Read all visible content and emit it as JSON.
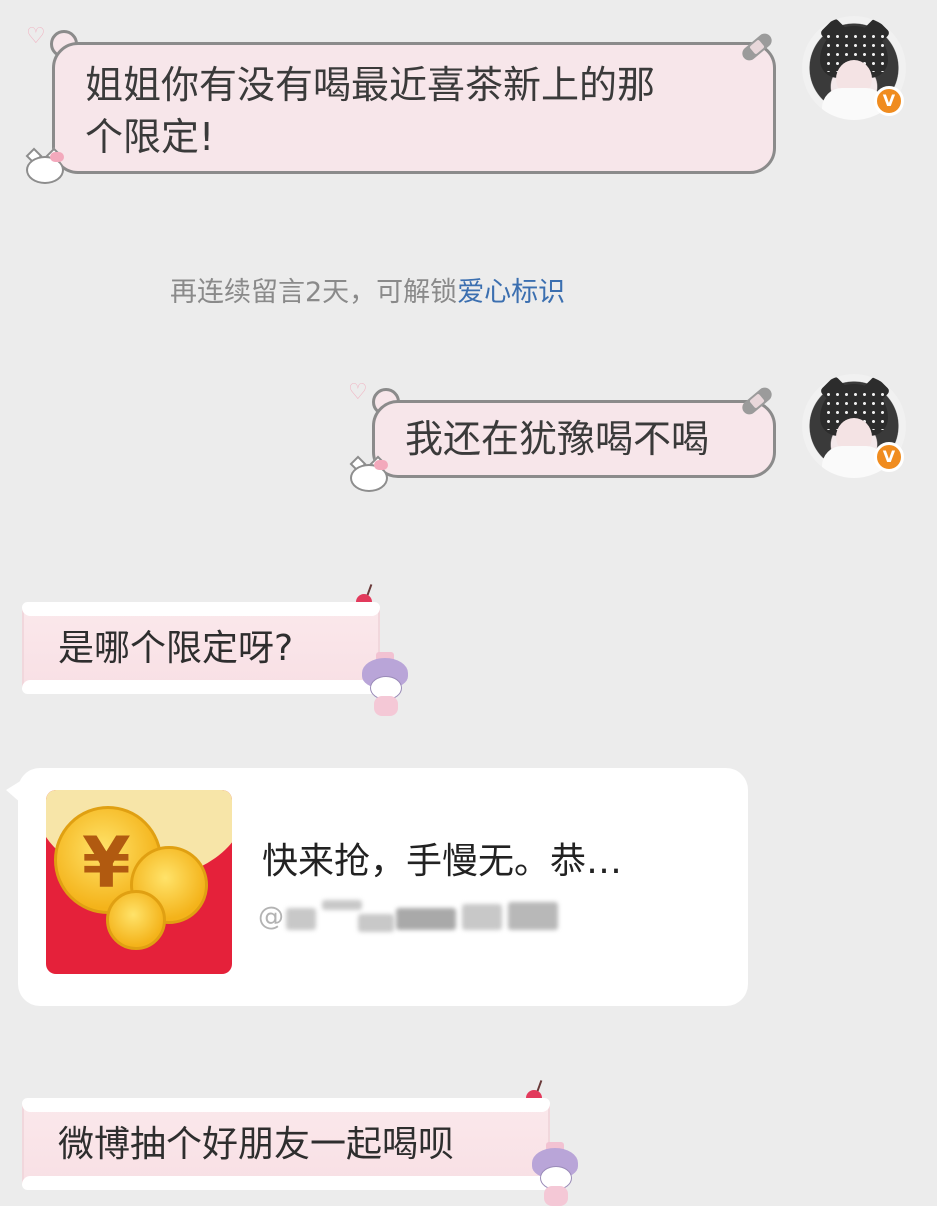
{
  "messages": [
    {
      "side": "right",
      "text_line1": "姐姐你有没有喝最近喜茶新上的那",
      "text_line2": "个限定!"
    },
    {
      "side": "right",
      "text": "我还在犹豫喝不喝"
    },
    {
      "side": "left",
      "text": "是哪个限定呀?"
    },
    {
      "side": "left",
      "text": "微博抽个好朋友一起喝呗"
    }
  ],
  "system": {
    "prefix": "再连续留言2天，可解锁",
    "link": "爱心标识"
  },
  "red_packet": {
    "title": "快来抢，手慢无。恭…",
    "subtitle_icon": "at-icon"
  },
  "avatar": {
    "badge": "V",
    "badge_color": "#f08c1f"
  },
  "colors": {
    "bubble_pink": "#f7e6ea",
    "link": "#3b6fb0",
    "packet_red": "#e5213a"
  }
}
